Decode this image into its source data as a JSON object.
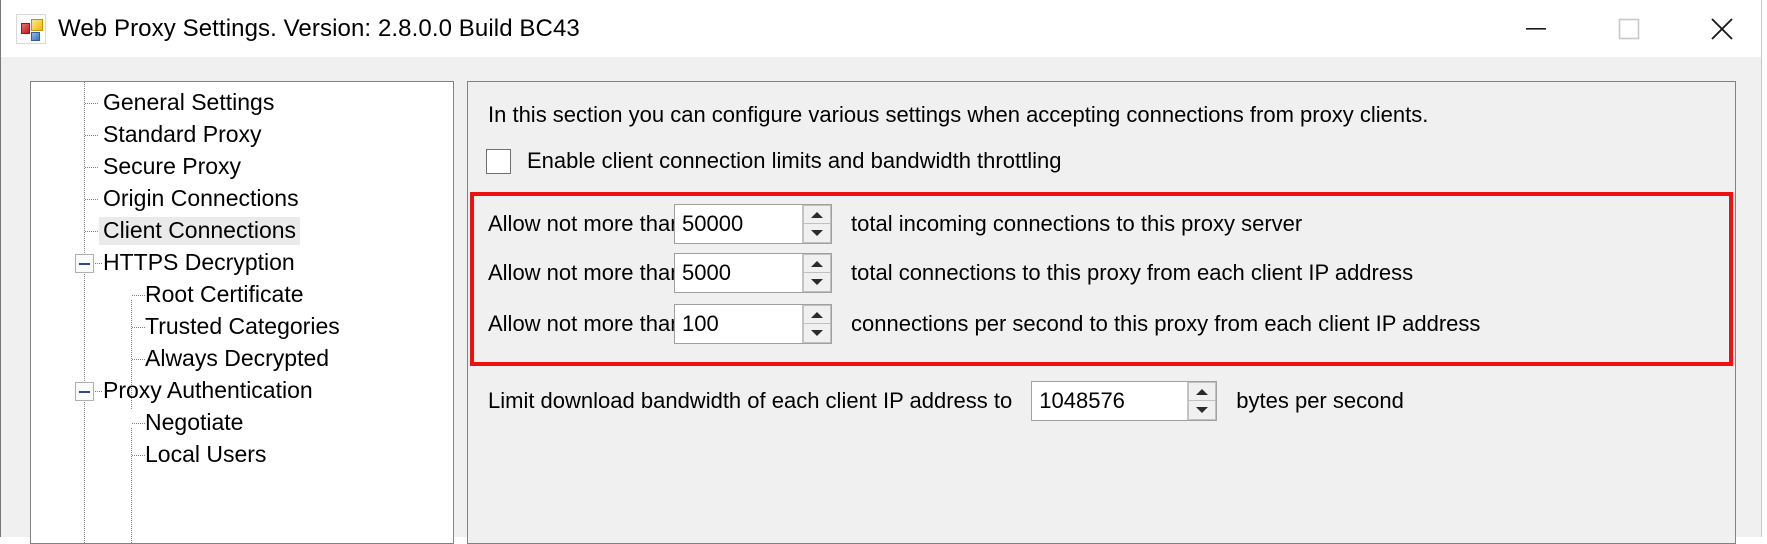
{
  "window": {
    "title": "Web Proxy Settings. Version: 2.8.0.0 Build BC43",
    "app_icon": "proxy-app-icon",
    "controls": {
      "minimize": "minimize-icon",
      "maximize": "maximize-icon",
      "close": "close-icon"
    }
  },
  "tree": {
    "selected": "Client Connections",
    "items": [
      {
        "label": "General Settings",
        "level": 1,
        "expander": "none",
        "selected": false
      },
      {
        "label": "Standard Proxy",
        "level": 1,
        "expander": "none",
        "selected": false
      },
      {
        "label": "Secure Proxy",
        "level": 1,
        "expander": "none",
        "selected": false
      },
      {
        "label": "Origin Connections",
        "level": 1,
        "expander": "none",
        "selected": false
      },
      {
        "label": "Client Connections",
        "level": 1,
        "expander": "none",
        "selected": true
      },
      {
        "label": "HTTPS Decryption",
        "level": 1,
        "expander": "minus",
        "selected": false
      },
      {
        "label": "Root Certificate",
        "level": 2,
        "expander": "none",
        "selected": false
      },
      {
        "label": "Trusted Categories",
        "level": 2,
        "expander": "none",
        "selected": false
      },
      {
        "label": "Always Decrypted",
        "level": 2,
        "expander": "none",
        "selected": false
      },
      {
        "label": "Proxy Authentication",
        "level": 1,
        "expander": "minus",
        "selected": false
      },
      {
        "label": "Negotiate",
        "level": 2,
        "expander": "none",
        "selected": false
      },
      {
        "label": "Local Users",
        "level": 2,
        "expander": "none",
        "selected": false
      }
    ]
  },
  "panel": {
    "description": "In this section you can configure various settings when accepting connections from proxy clients.",
    "enable_checkbox": {
      "label": "Enable client connection limits and bandwidth throttling",
      "checked": false
    },
    "highlight_color": "#ee1111",
    "limits": [
      {
        "label": "Allow not more than",
        "value": "50000",
        "suffix": "total incoming connections to this proxy server"
      },
      {
        "label": "Allow not more than",
        "value": "5000",
        "suffix": "total connections to this proxy from each client IP address"
      },
      {
        "label": "Allow not more than",
        "value": "100",
        "suffix": "connections per second to this proxy from each client IP address"
      }
    ],
    "bandwidth": {
      "label": "Limit download bandwidth of each client IP address to",
      "value": "1048576",
      "suffix": "bytes per second"
    }
  }
}
